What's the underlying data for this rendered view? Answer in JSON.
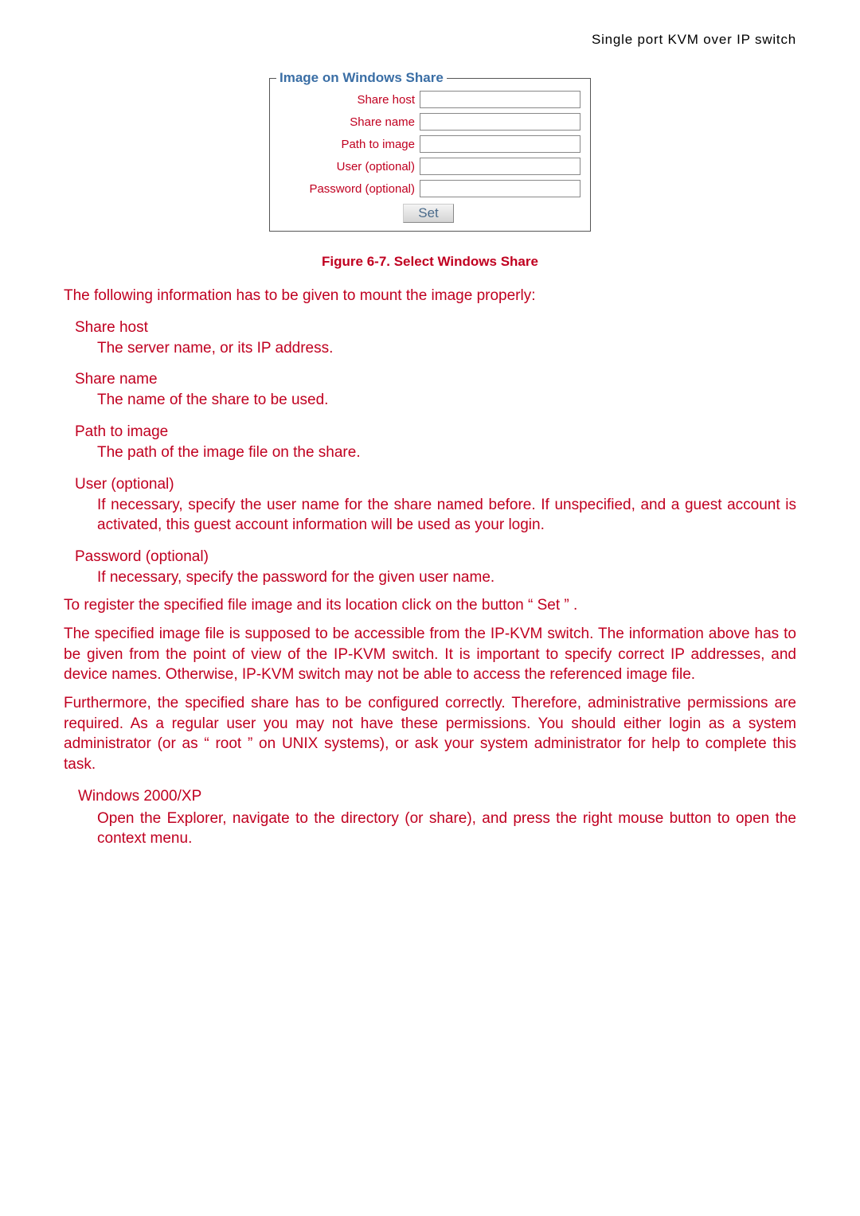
{
  "header": {
    "title": "Single port KVM over IP switch"
  },
  "fieldset": {
    "legend": "Image on Windows Share",
    "rows": {
      "share_host": {
        "label": "Share host",
        "value": ""
      },
      "share_name": {
        "label": "Share name",
        "value": ""
      },
      "path_to_image": {
        "label": "Path to image",
        "value": ""
      },
      "user_optional": {
        "label": "User (optional)",
        "value": ""
      },
      "password_optional": {
        "label": "Password (optional)",
        "value": ""
      }
    },
    "set_label": "Set"
  },
  "figure_caption": "Figure 6-7. Select Windows Share",
  "intro_text": "The following information has to be given to mount the image properly:",
  "defs": {
    "share_host": {
      "term": "Share host",
      "desc": "The server name, or its IP address."
    },
    "share_name": {
      "term": "Share name",
      "desc": "The name of the share to be used."
    },
    "path_to_image": {
      "term": "Path to image",
      "desc": "The path of the image file on the share."
    },
    "user_optional": {
      "term": "User (optional)",
      "desc": "If necessary, specify the user name for the share named before. If unspecified, and a guest account is activated, this guest account information will be used as your login."
    },
    "password_optional": {
      "term": "Password (optional)",
      "desc": "If necessary, specify the password for the given user name."
    }
  },
  "set_text": "To register the specified file image and its location click on the button “ Set ” .",
  "para1": "The specified image file is supposed to be accessible from the IP-KVM switch. The information above has to be given from the point of view of the IP-KVM switch. It is important to specify correct IP addresses, and device names. Otherwise, IP-KVM switch may not be able to access the referenced image file.",
  "para2": "Furthermore, the specified share has to be configured correctly. Therefore, administrative permissions are required. As a regular user you may not have these permissions. You should either login as a system administrator (or as “ root ” on UNIX systems), or ask your system administrator for help to complete this task.",
  "windows": {
    "term": "Windows 2000/XP",
    "desc": "Open the Explorer, navigate to the directory (or share), and press the right mouse button to open the context menu."
  }
}
